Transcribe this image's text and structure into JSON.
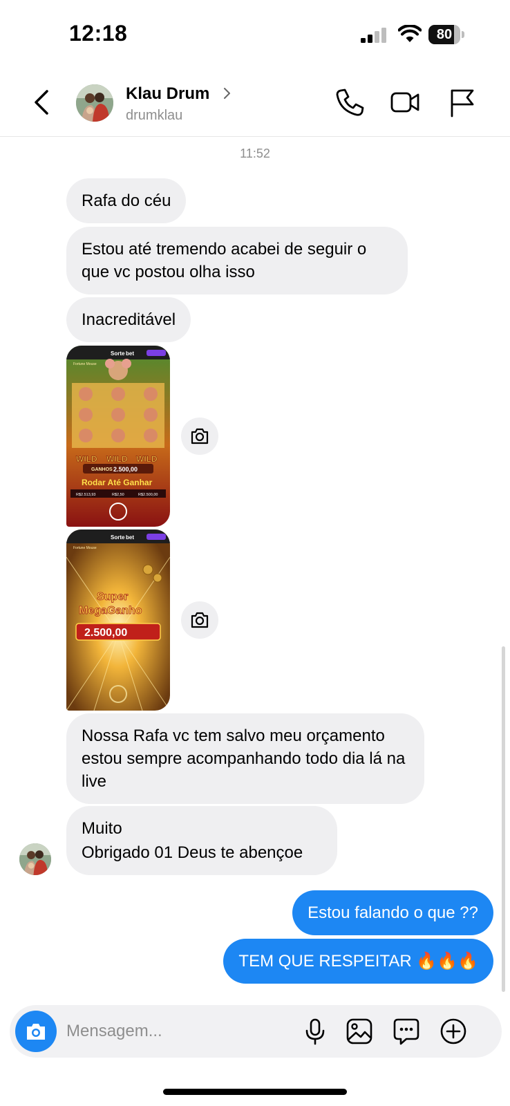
{
  "status_bar": {
    "time": "12:18",
    "battery_level": "80",
    "battery_fraction": 0.8
  },
  "header": {
    "contact_name": "Klau Drum",
    "contact_handle": "drumklau",
    "icons": [
      "back-arrow-icon",
      "chevron-right-icon",
      "phone-icon",
      "video-camera-icon",
      "flag-icon"
    ]
  },
  "chat": {
    "timestamp": "11:52",
    "messages": [
      {
        "direction": "in",
        "text": "Rafa do céu"
      },
      {
        "direction": "in",
        "text": "Estou até tremendo acabei de seguir o que vc postou olha isso"
      },
      {
        "direction": "in",
        "text": "Inacreditável"
      },
      {
        "direction": "in",
        "type": "image",
        "brand": "Sorte",
        "brand_suffix": "bet",
        "caption": "Fortune Mouse",
        "wild": [
          "WILD",
          "WILD",
          "WILD"
        ],
        "ganhos_label": "GANHOS",
        "ganhos_value": "2.500,00",
        "button": "Rodar Até Ganhar",
        "saldo": "R$2.513,93",
        "aposta": "R$2,50",
        "ganho": "R$2.500,00"
      },
      {
        "direction": "in",
        "type": "image",
        "brand": "Sorte",
        "brand_suffix": "bet",
        "caption": "Fortune Mouse",
        "title_line1": "Super",
        "title_line2": "MegaGanho",
        "value": "2.500,00"
      },
      {
        "direction": "in",
        "text": "Nossa Rafa vc tem salvo meu orçamento estou sempre acompanhando todo dia lá na live"
      },
      {
        "direction": "in",
        "text_line1": "Muito",
        "text_line2": "Obrigado 01 Deus te abençoe"
      },
      {
        "direction": "out",
        "text": "Estou falando o que ??"
      },
      {
        "direction": "out",
        "text": "TEM QUE RESPEITAR 🔥🔥🔥"
      }
    ]
  },
  "composer": {
    "placeholder": "Mensagem...",
    "icons": [
      "camera-icon",
      "microphone-icon",
      "gallery-icon",
      "sticker-icon",
      "add-icon"
    ]
  },
  "colors": {
    "outgoing_bubble": "#1d87f3",
    "incoming_bubble": "#efeff1",
    "secondary_text": "#8e8e8e"
  }
}
